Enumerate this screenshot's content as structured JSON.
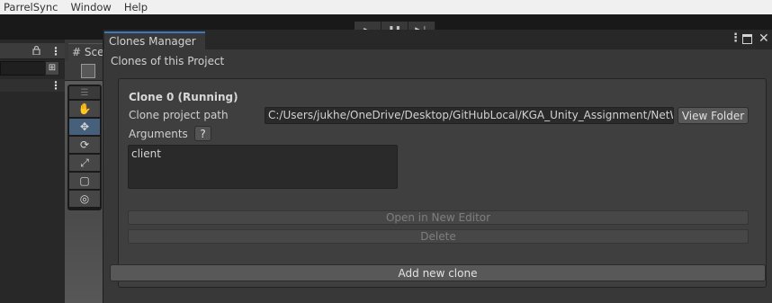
{
  "menubar": {
    "items": [
      "ParrelSync",
      "Window",
      "Help"
    ]
  },
  "toolbar": {
    "play_icon": "▶",
    "pause_icon": "❚❚",
    "step_icon": "▶❘"
  },
  "scene_tab": {
    "label": "Sce"
  },
  "clones_manager": {
    "tab_title": "Clones Manager",
    "subtitle": "Clones of this Project",
    "clone": {
      "title": "Clone 0 (Running)",
      "path_label": "Clone project path",
      "path_value": "C:/Users/jukhe/OneDrive/Desktop/GitHubLocal/KGA_Unity_Assignment/NetWork",
      "view_folder_label": "View Folder",
      "arguments_label": "Arguments",
      "help_label": "?",
      "arguments_value": "client",
      "open_editor_label": "Open in New Editor",
      "delete_label": "Delete"
    },
    "add_clone_label": "Add new clone"
  },
  "colors": {
    "accent_tab": "#3a79bb",
    "window_bg": "#383838",
    "clone_box_bg": "#3f3f3f",
    "button_bg": "#585858"
  },
  "icons": [
    "lock-icon",
    "more-icon",
    "hand-tool-icon",
    "move-tool-icon",
    "rotate-tool-icon",
    "scale-tool-icon",
    "rect-tool-icon",
    "transform-tool-icon",
    "maximize-icon",
    "close-icon",
    "play-icon",
    "pause-icon",
    "step-icon"
  ]
}
